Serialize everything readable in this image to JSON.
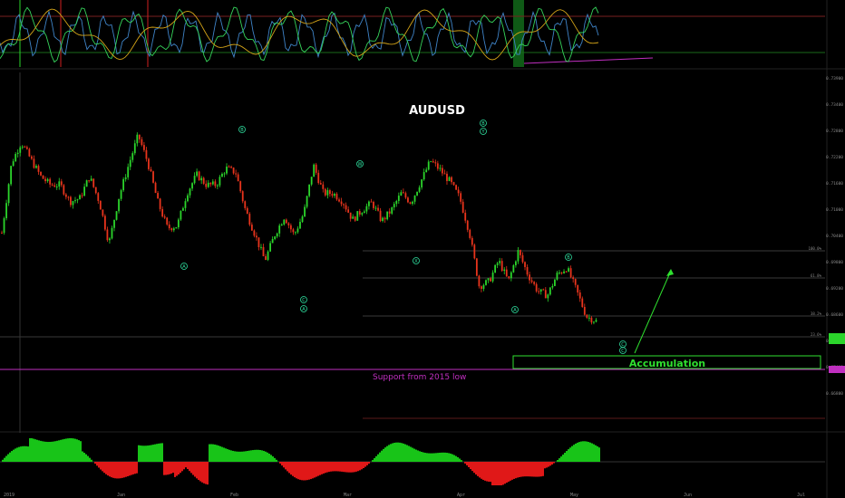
{
  "title": "AUDUSD",
  "annotations": {
    "accumulation_label": "Accumulation",
    "support_label": "Support from 2015 low"
  },
  "wave_labels": [
    "A",
    "B",
    "C",
    "A",
    "W",
    "X",
    "B",
    "Y",
    "A",
    "B",
    "C",
    "C"
  ],
  "colors": {
    "background": "#000000",
    "candle_up": "#2bd52b",
    "candle_down": "#e8341c",
    "accumulation": "#2fe02f",
    "support": "#c02fc0",
    "title": "#ffffff",
    "fib_line": "#3a3a3a",
    "osc_line_1": "#3f84c8",
    "osc_line_2": "#35d35a",
    "osc_line_3": "#d4a418",
    "hist_pos": "#18c418",
    "hist_neg": "#e01818"
  },
  "chart_data": {
    "type": "line",
    "title": "AUDUSD",
    "series": [
      {
        "values": [
          0.7055,
          0.7205,
          0.725,
          0.7212,
          0.7176,
          0.7158,
          0.7158,
          0.7122,
          0.7129,
          0.7176,
          0.7122,
          0.7032,
          0.713,
          0.72,
          0.7265,
          0.7205,
          0.7122,
          0.7065,
          0.707,
          0.714,
          0.718,
          0.7158,
          0.7158,
          0.7194,
          0.7185,
          0.7104,
          0.705,
          0.6995,
          0.705,
          0.709,
          0.705,
          0.7097,
          0.72,
          0.714,
          0.714,
          0.7122,
          0.7083,
          0.7104,
          0.712,
          0.708,
          0.7104,
          0.714,
          0.712,
          0.7165,
          0.721,
          0.719,
          0.7165,
          0.713,
          0.7055,
          0.694,
          0.695,
          0.6995,
          0.695,
          0.7015,
          0.6965,
          0.693,
          0.692,
          0.6965,
          0.698,
          0.693,
          0.6875,
          0.6865
        ]
      }
    ],
    "price_axis": [
      "0.73900",
      "0.73400",
      "0.72800",
      "0.72200",
      "0.71600",
      "0.71000",
      "0.70400",
      "0.69800",
      "0.69200",
      "0.68600",
      "0.68000",
      "0.67400",
      "0.66800"
    ],
    "date_axis": [
      "2019",
      "Jan",
      "Feb",
      "Mar",
      "Apr",
      "May",
      "Jun",
      "Jul"
    ],
    "fib_levels": [
      "100.0%",
      "61.8%",
      "38.2%",
      "23.6%"
    ],
    "ylim": [
      0.664,
      0.74
    ]
  }
}
